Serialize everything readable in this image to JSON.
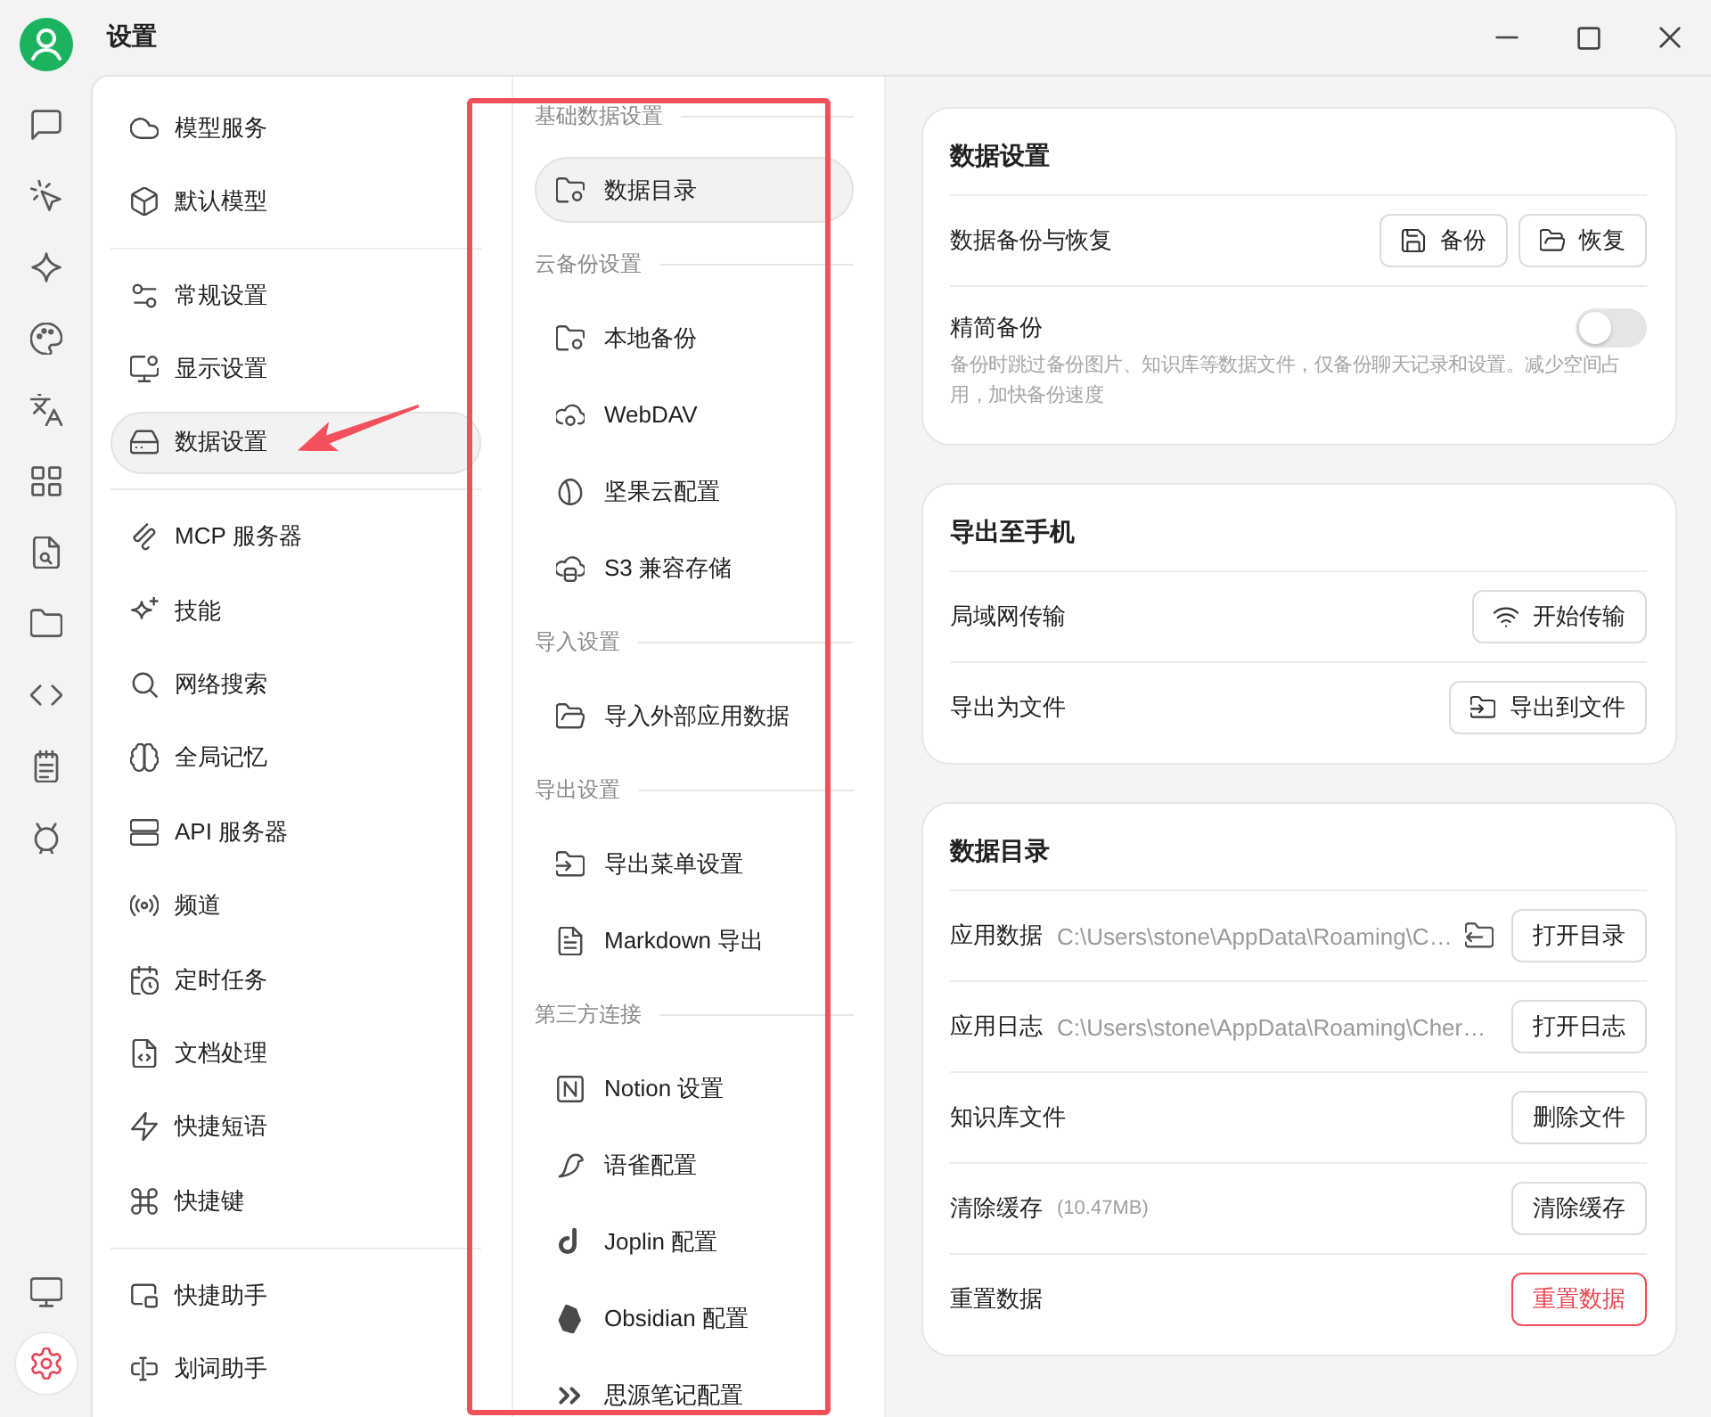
{
  "window": {
    "title": "设置"
  },
  "rail": {
    "top": [
      {
        "selected": false
      },
      {
        "selected": false
      },
      {
        "selected": false
      },
      {
        "selected": false
      },
      {
        "selected": false
      },
      {
        "selected": false
      },
      {
        "selected": false
      },
      {
        "selected": false
      },
      {
        "selected": false
      },
      {
        "selected": false
      },
      {
        "selected": false
      }
    ],
    "bottom": [
      {
        "selected": false
      },
      {
        "selected": true
      }
    ]
  },
  "sidebar": {
    "groups": [
      {
        "items": [
          {
            "label": "模型服务",
            "selected": false
          },
          {
            "label": "默认模型",
            "selected": false
          }
        ]
      },
      {
        "items": [
          {
            "label": "常规设置",
            "selected": false
          },
          {
            "label": "显示设置",
            "selected": false
          },
          {
            "label": "数据设置",
            "selected": true
          }
        ]
      },
      {
        "items": [
          {
            "label": "MCP 服务器",
            "selected": false
          },
          {
            "label": "技能",
            "selected": false
          },
          {
            "label": "网络搜索",
            "selected": false
          },
          {
            "label": "全局记忆",
            "selected": false
          },
          {
            "label": "API 服务器",
            "selected": false
          },
          {
            "label": "频道",
            "selected": false
          },
          {
            "label": "定时任务",
            "selected": false
          },
          {
            "label": "文档处理",
            "selected": false
          },
          {
            "label": "快捷短语",
            "selected": false
          },
          {
            "label": "快捷键",
            "selected": false
          }
        ]
      },
      {
        "items": [
          {
            "label": "快捷助手",
            "selected": false
          },
          {
            "label": "划词助手",
            "selected": false
          }
        ]
      }
    ]
  },
  "data_menu": {
    "sections": [
      {
        "heading": "基础数据设置",
        "items": [
          {
            "label": "数据目录",
            "selected": true
          }
        ]
      },
      {
        "heading": "云备份设置",
        "items": [
          {
            "label": "本地备份",
            "selected": false
          },
          {
            "label": "WebDAV",
            "selected": false
          },
          {
            "label": "坚果云配置",
            "selected": false
          },
          {
            "label": "S3 兼容存储",
            "selected": false
          }
        ]
      },
      {
        "heading": "导入设置",
        "items": [
          {
            "label": "导入外部应用数据",
            "selected": false
          }
        ]
      },
      {
        "heading": "导出设置",
        "items": [
          {
            "label": "导出菜单设置",
            "selected": false
          },
          {
            "label": "Markdown 导出",
            "selected": false
          }
        ]
      },
      {
        "heading": "第三方连接",
        "items": [
          {
            "label": "Notion 设置",
            "selected": false
          },
          {
            "label": "语雀配置",
            "selected": false
          },
          {
            "label": "Joplin 配置",
            "selected": false
          },
          {
            "label": "Obsidian 配置",
            "selected": false
          },
          {
            "label": "思源笔记配置",
            "selected": false
          }
        ]
      }
    ]
  },
  "cards": [
    {
      "title": "数据设置",
      "rows": [
        {
          "kind": "action",
          "label": "数据备份与恢复",
          "buttons": [
            {
              "label": "备份",
              "danger": false
            },
            {
              "label": "恢复",
              "danger": false
            }
          ]
        },
        {
          "kind": "toggle",
          "label": "精简备份",
          "on": false,
          "description": "备份时跳过备份图片、知识库等数据文件，仅备份聊天记录和设置。减少空间占用，加快备份速度"
        }
      ]
    },
    {
      "title": "导出至手机",
      "rows": [
        {
          "kind": "action",
          "label": "局域网传输",
          "buttons": [
            {
              "label": "开始传输",
              "danger": false
            }
          ]
        },
        {
          "kind": "action",
          "label": "导出为文件",
          "buttons": [
            {
              "label": "导出到文件",
              "danger": false
            }
          ]
        }
      ]
    },
    {
      "title": "数据目录",
      "rows": [
        {
          "kind": "path",
          "label": "应用数据",
          "detail": "C:\\Users\\stone\\AppData\\Roaming\\C…",
          "buttons": [
            {
              "label": "打开目录",
              "danger": false
            }
          ]
        },
        {
          "kind": "path",
          "label": "应用日志",
          "detail": "C:\\Users\\stone\\AppData\\Roaming\\Cher…",
          "buttons": [
            {
              "label": "打开日志",
              "danger": false
            }
          ]
        },
        {
          "kind": "action",
          "label": "知识库文件",
          "buttons": [
            {
              "label": "删除文件",
              "danger": false
            }
          ]
        },
        {
          "kind": "action",
          "label": "清除缓存",
          "detail": "(10.47MB)",
          "buttons": [
            {
              "label": "清除缓存",
              "danger": false
            }
          ]
        },
        {
          "kind": "action",
          "label": "重置数据",
          "buttons": [
            {
              "label": "重置数据",
              "danger": true
            }
          ]
        }
      ]
    }
  ]
}
